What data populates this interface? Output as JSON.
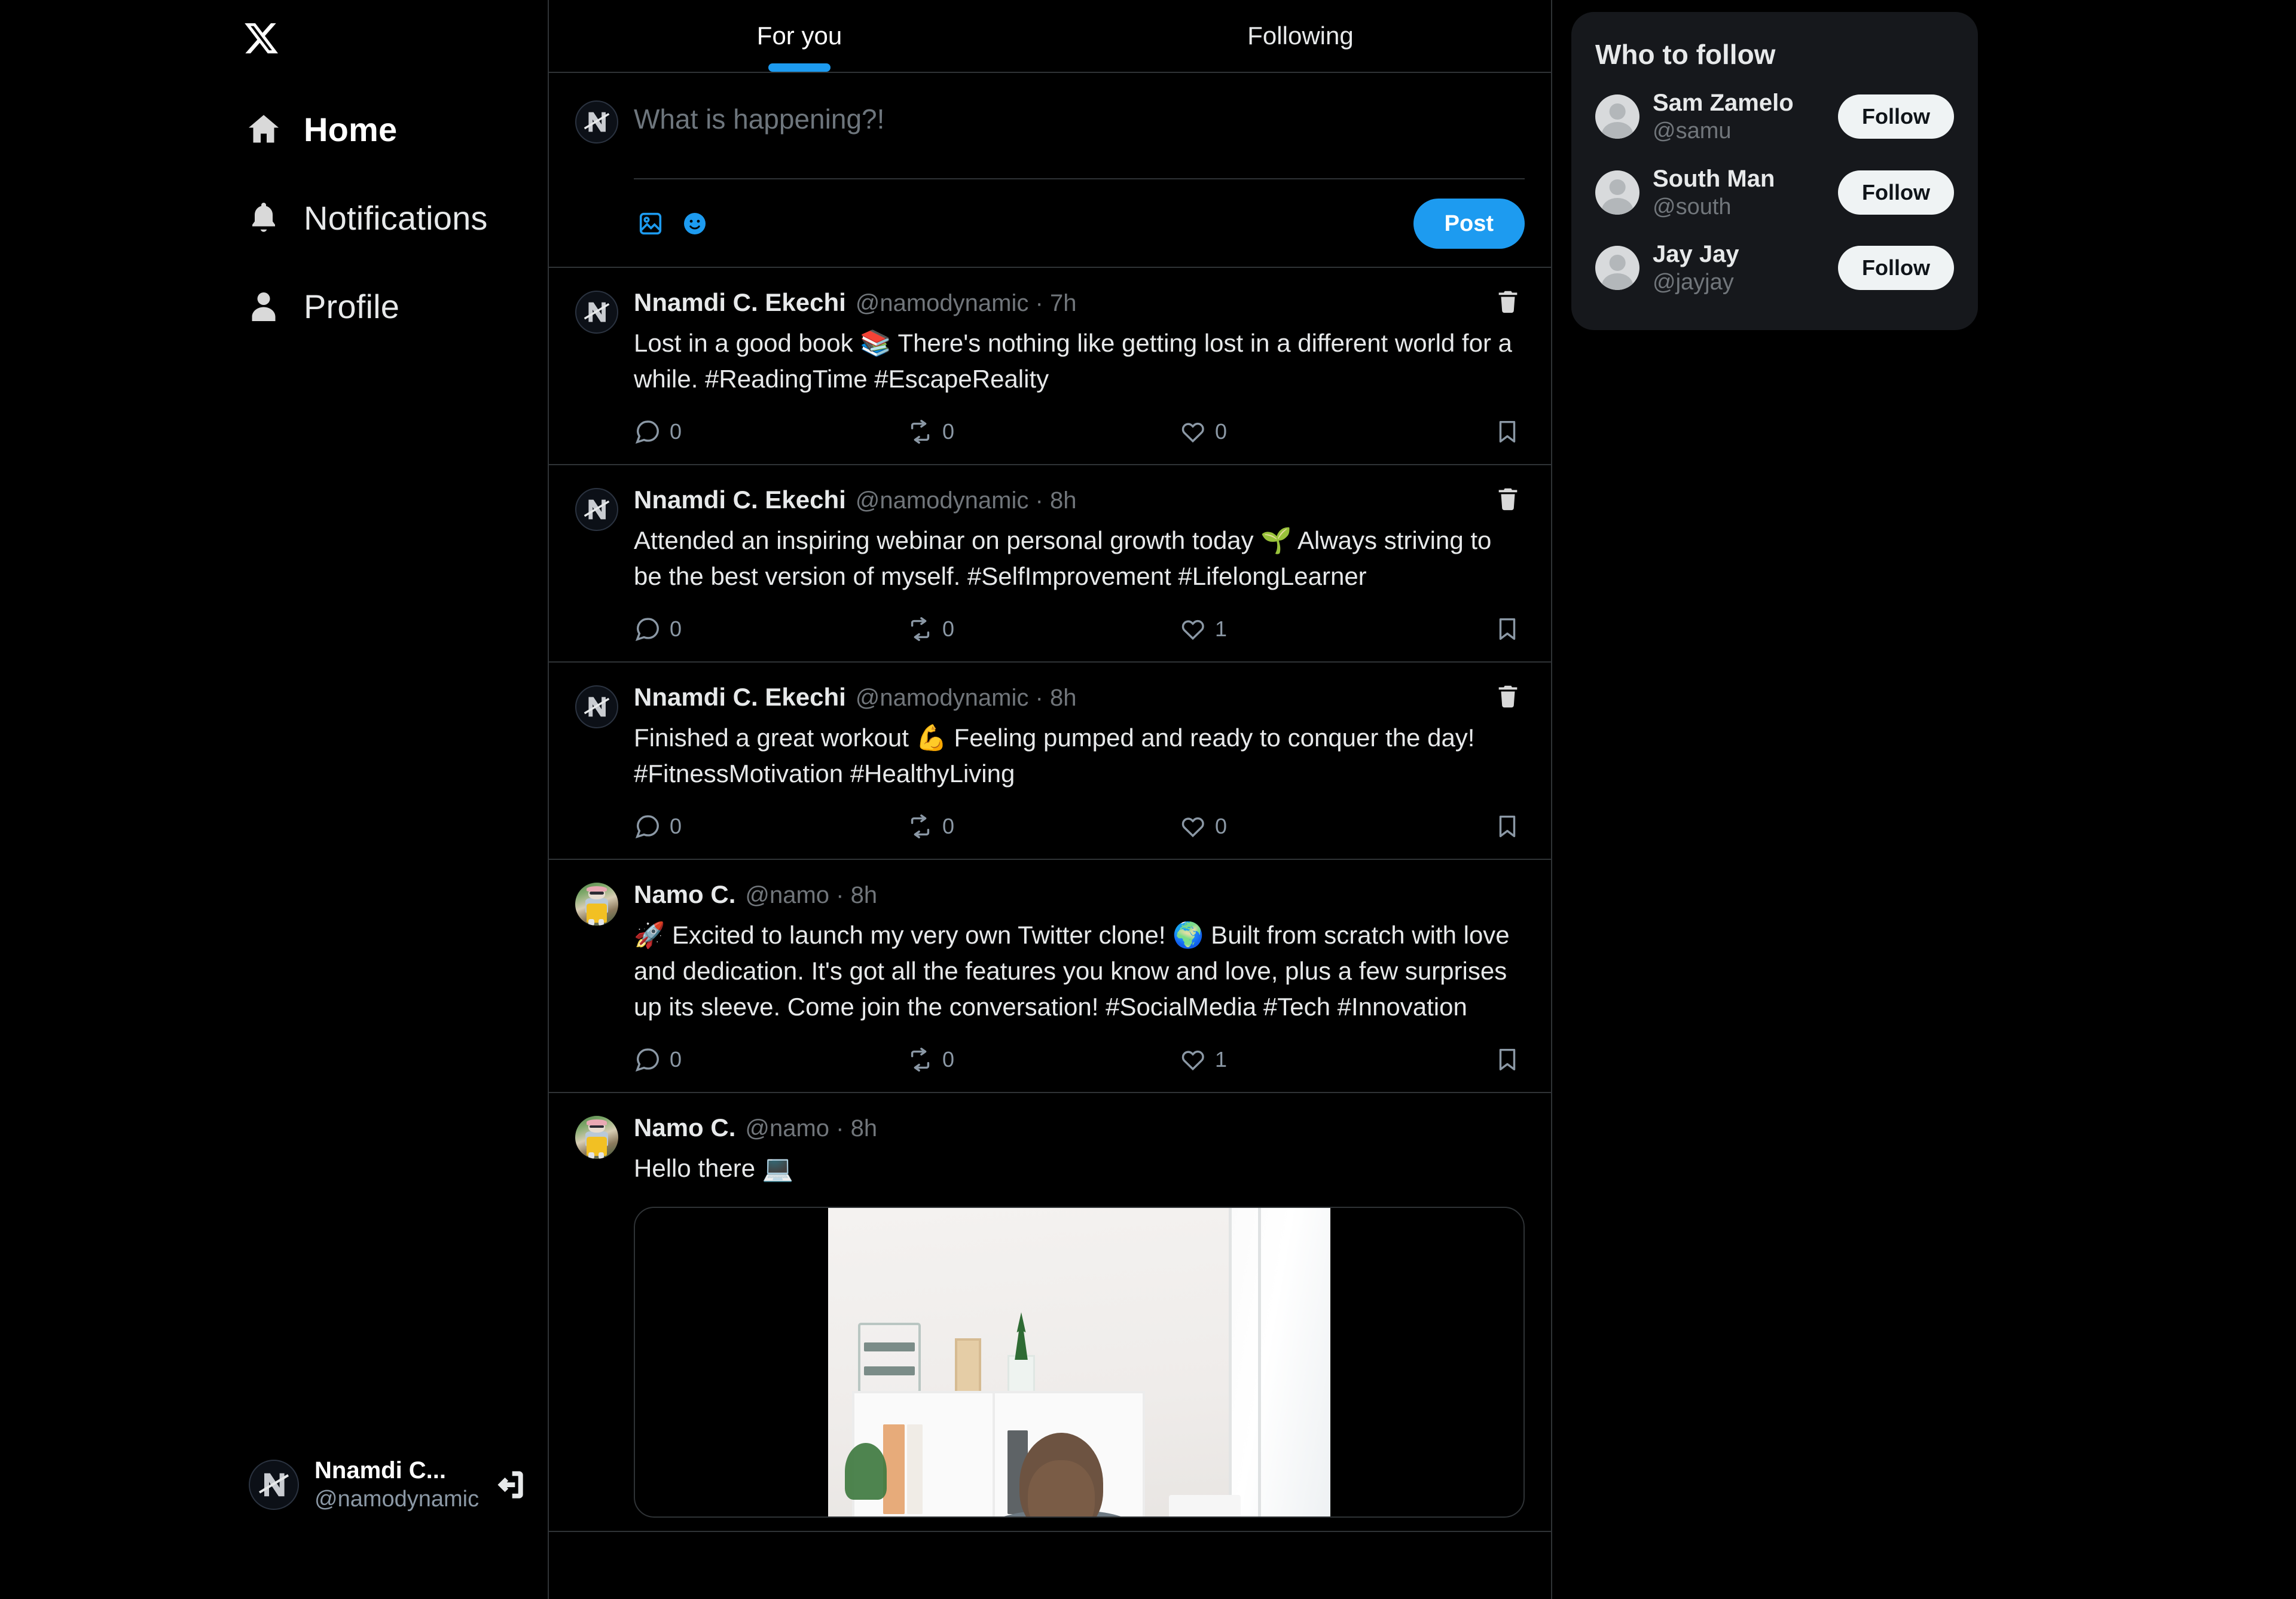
{
  "brand": {
    "logo": "x-logo",
    "accent_color": "#1d9bf0",
    "background_color": "#000000",
    "border_color": "#2f3336",
    "panel_color": "#16181c"
  },
  "sidebar": {
    "items": [
      {
        "label": "Home",
        "icon": "home-icon",
        "active": true
      },
      {
        "label": "Notifications",
        "icon": "bell-icon",
        "active": false
      },
      {
        "label": "Profile",
        "icon": "person-icon",
        "active": false
      }
    ],
    "user": {
      "name": "Nnamdi C...",
      "handle": "@namodynamic",
      "avatar": "n-logo-avatar",
      "logout_icon": "logout-icon"
    }
  },
  "main": {
    "tabs": [
      {
        "label": "For you",
        "active": true
      },
      {
        "label": "Following",
        "active": false
      }
    ],
    "compose": {
      "avatar": "n-logo-avatar",
      "placeholder": "What is happening?!",
      "value": "",
      "media_icon": "image-icon",
      "emoji_icon": "emoji-icon",
      "post_label": "Post"
    },
    "tweets": [
      {
        "avatar": "n-logo-avatar",
        "name": "Nnamdi C. Ekechi",
        "handle": "@namodynamic",
        "separator": "·",
        "time": "7h",
        "text": "Lost in a good book 📚 There's nothing like getting lost in a different world for a while. #ReadingTime #EscapeReality",
        "delete_icon": "trash-icon",
        "actions": {
          "reply_count": "0",
          "retweet_count": "0",
          "like_count": "0",
          "bookmark_icon": "bookmark-icon"
        },
        "media": null
      },
      {
        "avatar": "n-logo-avatar",
        "name": "Nnamdi C. Ekechi",
        "handle": "@namodynamic",
        "separator": "·",
        "time": "8h",
        "text": "Attended an inspiring webinar on personal growth today 🌱 Always striving to be the best version of myself. #SelfImprovement #LifelongLearner",
        "delete_icon": "trash-icon",
        "actions": {
          "reply_count": "0",
          "retweet_count": "0",
          "like_count": "1",
          "bookmark_icon": "bookmark-icon"
        },
        "media": null
      },
      {
        "avatar": "n-logo-avatar",
        "name": "Nnamdi C. Ekechi",
        "handle": "@namodynamic",
        "separator": "·",
        "time": "8h",
        "text": "Finished a great workout 💪 Feeling pumped and ready to conquer the day! #FitnessMotivation #HealthyLiving",
        "delete_icon": "trash-icon",
        "actions": {
          "reply_count": "0",
          "retweet_count": "0",
          "like_count": "0",
          "bookmark_icon": "bookmark-icon"
        },
        "media": null
      },
      {
        "avatar": "character-photo-avatar",
        "name": "Namo C.",
        "handle": "@namo",
        "separator": "·",
        "time": "8h",
        "text": "🚀 Excited to launch my very own Twitter clone! 🌍 Built from scratch with love and dedication. It's got all the features you know and love, plus a few surprises up its sleeve. Come join the conversation! #SocialMedia #Tech #Innovation",
        "delete_icon": null,
        "actions": {
          "reply_count": "0",
          "retweet_count": "0",
          "like_count": "1",
          "bookmark_icon": "bookmark-icon"
        },
        "media": null
      },
      {
        "avatar": "character-photo-avatar",
        "name": "Namo C.",
        "handle": "@namo",
        "separator": "·",
        "time": "8h",
        "text": "Hello there 💻",
        "delete_icon": null,
        "actions": null,
        "media": "office-workspace-photo"
      }
    ]
  },
  "right_panel": {
    "who_to_follow": {
      "title": "Who to follow",
      "suggestions": [
        {
          "name": "Sam Zamelo",
          "handle": "@samu",
          "avatar": "default-person-avatar",
          "follow_label": "Follow"
        },
        {
          "name": "South Man",
          "handle": "@south",
          "avatar": "default-person-avatar",
          "follow_label": "Follow"
        },
        {
          "name": "Jay Jay",
          "handle": "@jayjay",
          "avatar": "default-person-avatar",
          "follow_label": "Follow"
        }
      ]
    }
  }
}
